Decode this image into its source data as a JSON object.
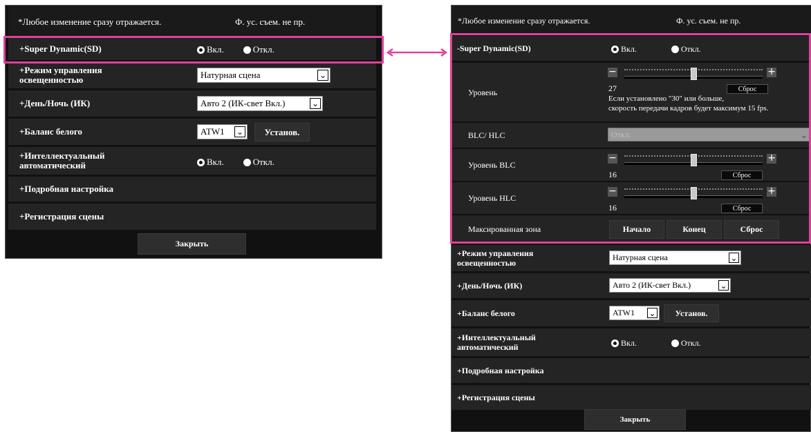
{
  "notice": "*Любое изменение сразу отражается.",
  "notice_right": "*Любое изменение сразу отражается.",
  "header_link": "Ф. ус. съем. не пр.",
  "left": {
    "sd_label": "+Super Dynamic(SD)",
    "on_label": "Вкл.",
    "off_label": "Откл.",
    "lighting_label": "+Режим управления освещенностью",
    "lighting_value": "Натурная сцена",
    "daynight_label": "+День/Ночь (ИК)",
    "daynight_value": "Авто 2 (ИК-свет Вкл.)",
    "wb_label": "+Баланс белого",
    "wb_value": "ATW1",
    "wb_button": "Установ.",
    "ia_label": "+Интеллектуальный автоматический",
    "detail_label": "+Подробная настройка",
    "scene_label": "+Регистрация сцены",
    "close_button": "Закрыть"
  },
  "right": {
    "sd_label": "-Super Dynamic(SD)",
    "on_label": "Вкл.",
    "off_label": "Откл.",
    "level_label": "Уровень",
    "level_value": "27",
    "level_note_1": "Если установлено \"30\" или больше,",
    "level_note_2": "скорость передачи кадров будет максимум 15 fps.",
    "reset_label": "Сброс",
    "blc_hlc_label": "BLC/ HLC",
    "blc_hlc_value": "Откл.",
    "blc_level_label": "Уровень BLC",
    "blc_level_value": "16",
    "hlc_level_label": "Уровень HLC",
    "hlc_level_value": "16",
    "mask_label": "Максированная зона",
    "mask_start": "Начало",
    "mask_end": "Конец",
    "mask_reset": "Сброс",
    "lighting_label": "+Режим управления освещенностью",
    "lighting_value": "Натурная сцена",
    "daynight_label": "+День/Ночь (ИК)",
    "daynight_value": "Авто 2 (ИК-свет Вкл.)",
    "wb_label": "+Баланс белого",
    "wb_value": "ATW1",
    "wb_button": "Установ.",
    "ia_label": "+Интеллектуальный автоматический",
    "detail_label": "+Подробная настройка",
    "scene_label": "+Регистрация сцены",
    "close_button": "Закрыть"
  },
  "sliders": {
    "level": 27,
    "blc": 16,
    "hlc": 16
  },
  "colors": {
    "highlight": "#e0409a",
    "panel_bg": "#111111",
    "row_bg": "#242424"
  }
}
